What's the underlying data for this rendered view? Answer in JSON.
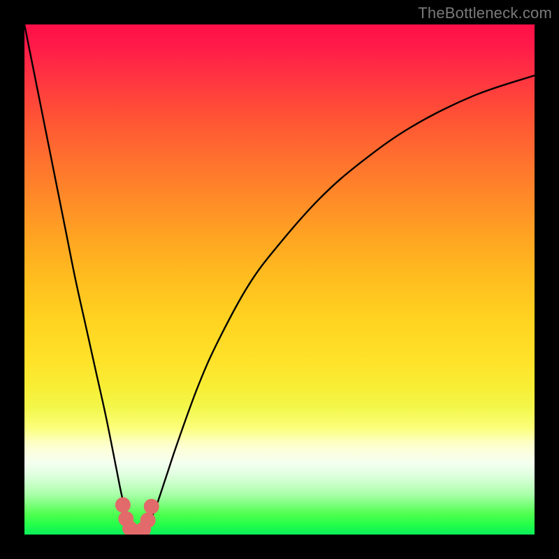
{
  "watermark": "TheBottleneck.com",
  "colors": {
    "frame_bg": "#000000",
    "curve_stroke": "#000000",
    "marker_fill": "#e26a6a",
    "marker_stroke": "#d15959",
    "watermark": "#7a7a7a"
  },
  "chart_data": {
    "type": "line",
    "title": "",
    "xlabel": "",
    "ylabel": "",
    "xlim": [
      0,
      100
    ],
    "ylim": [
      0,
      100
    ],
    "grid": false,
    "legend": false,
    "series": [
      {
        "name": "bottleneck-curve",
        "description": "V-shaped curve approaching 0 near x≈22 (left branch steep, right branch asymptotically decreasing rise)",
        "x": [
          0,
          2,
          4,
          6,
          8,
          10,
          12,
          14,
          16,
          18,
          19,
          20,
          21,
          22,
          23,
          24,
          25,
          26,
          28,
          30,
          34,
          38,
          44,
          50,
          58,
          66,
          76,
          88,
          100
        ],
        "y": [
          100,
          90,
          80,
          70,
          60,
          50,
          41,
          32,
          23,
          13,
          8,
          4,
          1.2,
          0.3,
          0.6,
          1.5,
          3.5,
          6,
          12,
          18,
          29,
          38,
          49,
          57,
          66,
          73,
          80,
          86,
          90
        ],
        "color": "#000000"
      }
    ],
    "markers": {
      "name": "bottom-u-cluster",
      "color": "#e26a6a",
      "radius_px": 11,
      "points": [
        {
          "x": 19.3,
          "y": 5.8
        },
        {
          "x": 19.9,
          "y": 3.1
        },
        {
          "x": 20.7,
          "y": 1.2
        },
        {
          "x": 22.0,
          "y": 0.5
        },
        {
          "x": 23.3,
          "y": 1.0
        },
        {
          "x": 24.2,
          "y": 2.8
        },
        {
          "x": 24.9,
          "y": 5.5
        }
      ]
    },
    "background_gradient": {
      "direction": "vertical",
      "stops": [
        {
          "pos": 0.0,
          "color": "#ff1048"
        },
        {
          "pos": 0.5,
          "color": "#ffbe1f"
        },
        {
          "pos": 0.8,
          "color": "#fbff78"
        },
        {
          "pos": 1.0,
          "color": "#0bee59"
        }
      ]
    }
  }
}
